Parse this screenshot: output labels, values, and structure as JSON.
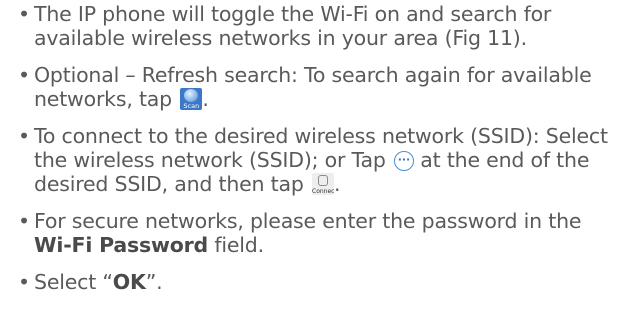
{
  "bullet_char": "•",
  "items": [
    {
      "text": "The IP phone will toggle the Wi-Fi on and search for available wireless networks in your area (Fig 11)."
    },
    {
      "before": "Optional – Refresh search: To search again for available networks, tap",
      "after": ".",
      "icon": {
        "name": "scan-icon",
        "label": "Scan"
      }
    },
    {
      "before": "To connect to the desired wireless network (SSID): Select the wireless network (SSID); or Tap",
      "middle": "at the end of the desired SSID, and then tap",
      "after": ".",
      "more_icon": {
        "name": "more-icon",
        "glyph": "···"
      },
      "icon": {
        "name": "connect-icon",
        "label": "Connect"
      }
    },
    {
      "before": "For secure networks, please enter the password in the",
      "bold": "Wi-Fi Password",
      "after": "field."
    },
    {
      "before": "Select “",
      "bold": "OK",
      "after": "”."
    }
  ],
  "colors": {
    "text": "#5a5a5a",
    "scan_icon_bg": "#3d78c8",
    "more_icon_ring": "#4a8fd6"
  }
}
